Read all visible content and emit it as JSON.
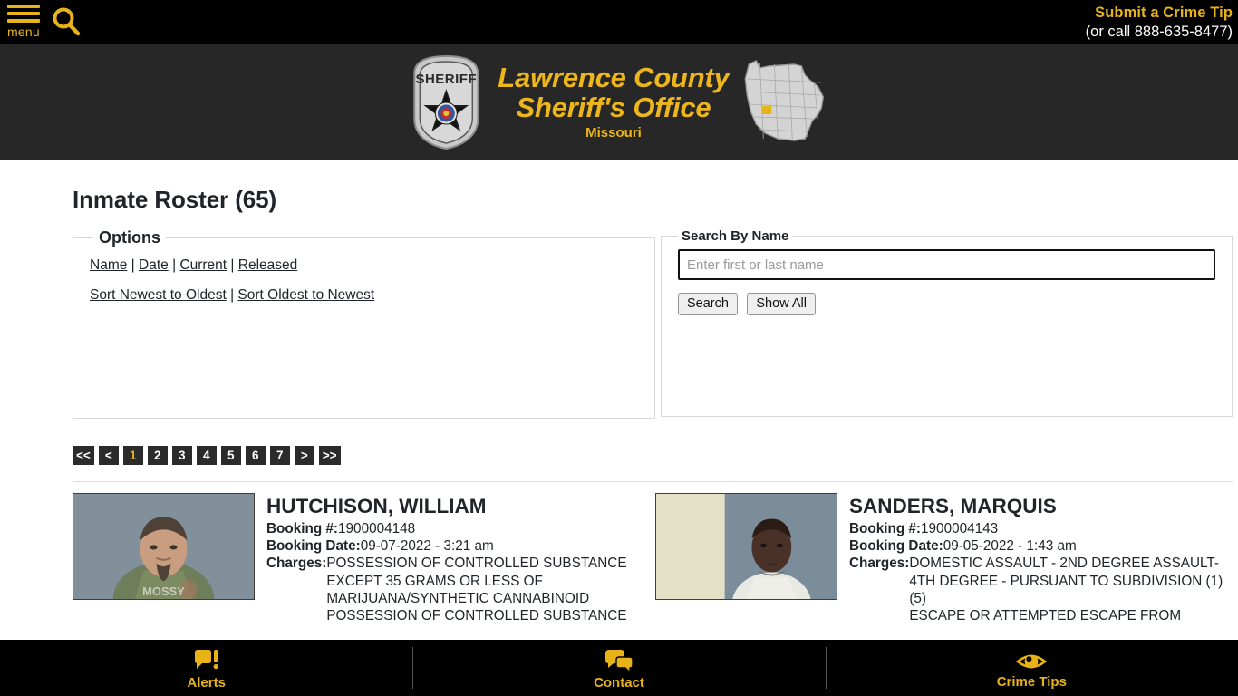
{
  "topbar": {
    "menu_icon": "hamburger-icon",
    "menu_label": "menu",
    "search_icon": "search-icon",
    "tip_link": "Submit a Crime Tip",
    "tip_phone": "(or call 888-635-8477)"
  },
  "brand": {
    "badge_icon": "sheriff-badge-icon",
    "line1": "Lawrence County",
    "line2": "Sheriff's Office",
    "sub": "Missouri",
    "map_icon": "missouri-state-map-icon",
    "accent_color": "#ecb61c",
    "band_color": "#272727"
  },
  "page": {
    "title": "Inmate Roster (65)"
  },
  "options": {
    "legend": "Options",
    "filters": [
      "Name",
      "Date",
      "Current",
      "Released"
    ],
    "sorts": [
      "Sort Newest to Oldest",
      "Sort Oldest to Newest"
    ],
    "separator": "|"
  },
  "search": {
    "legend": "Search By Name",
    "placeholder": "Enter first or last name",
    "value": "",
    "search_label": "Search",
    "show_all_label": "Show All"
  },
  "pagination": {
    "first": "<<",
    "prev": "<",
    "pages": [
      "1",
      "2",
      "3",
      "4",
      "5",
      "6",
      "7"
    ],
    "current": "1",
    "next": ">",
    "last": ">>",
    "active_color": "#e8b318"
  },
  "roster": {
    "labels": {
      "booking_no": "Booking #:",
      "booking_date": "Booking Date:",
      "charges": "Charges:"
    },
    "inmates": [
      {
        "name": "HUTCHISON, WILLIAM",
        "booking_no": "1900004148",
        "booking_date": "09-07-2022 - 3:21 am",
        "charges": "POSSESSION OF CONTROLLED SUBSTANCE EXCEPT 35 GRAMS OR LESS OF MARIJUANA/SYNTHETIC CANNABINOID\nPOSSESSION OF CONTROLLED SUBSTANCE",
        "mugshot": "mugshot-photo"
      },
      {
        "name": "SANDERS, MARQUIS",
        "booking_no": "1900004143",
        "booking_date": "09-05-2022 - 1:43 am",
        "charges": "DOMESTIC ASSAULT - 2ND DEGREE ASSAULT- 4TH DEGREE - PURSUANT TO SUBDIVISION (1) (5)\nESCAPE OR ATTEMPTED ESCAPE FROM",
        "mugshot": "mugshot-photo"
      }
    ]
  },
  "bottomnav": {
    "items": [
      {
        "label": "Alerts",
        "icon": "alert-speech-bubble-icon"
      },
      {
        "label": "Contact",
        "icon": "chat-bubbles-icon"
      },
      {
        "label": "Crime Tips",
        "icon": "eye-icon"
      }
    ]
  }
}
